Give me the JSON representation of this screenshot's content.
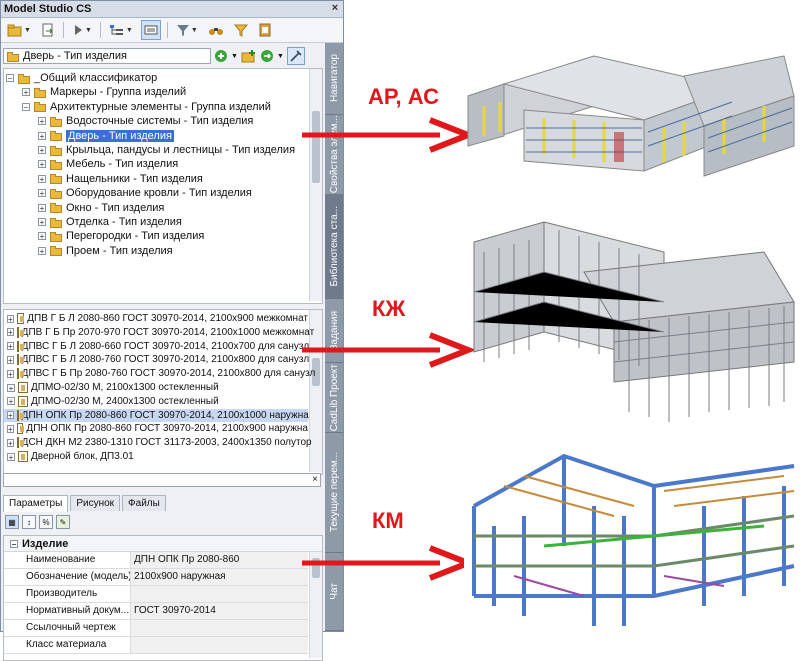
{
  "window": {
    "title": "Model Studio CS",
    "close_glyph": "×"
  },
  "path": {
    "value": "Дверь - Тип изделия"
  },
  "side_tabs": [
    "Навигатор",
    "Свойства элем...",
    "Библиотека ста...",
    "Задания",
    "CadLib Проект",
    "Текущие перем...",
    "Чат"
  ],
  "tree": {
    "items": [
      {
        "label": "_Общий классификатор",
        "level": 1,
        "pm": "−"
      },
      {
        "label": "Маркеры - Группа изделий",
        "level": 2,
        "pm": "+"
      },
      {
        "label": "Архитектурные элементы - Группа изделий",
        "level": 2,
        "pm": "−"
      },
      {
        "label": "Водосточные системы - Тип изделия",
        "level": 3,
        "pm": "+"
      },
      {
        "label": "Дверь - Тип изделия",
        "level": 3,
        "pm": "+",
        "selected": true
      },
      {
        "label": "Крыльца, пандусы и лестницы - Тип изделия",
        "level": 3,
        "pm": "+"
      },
      {
        "label": "Мебель - Тип изделия",
        "level": 3,
        "pm": "+"
      },
      {
        "label": "Нащельники - Тип изделия",
        "level": 3,
        "pm": "+"
      },
      {
        "label": "Оборудование кровли - Тип изделия",
        "level": 3,
        "pm": "+"
      },
      {
        "label": "Окно - Тип изделия",
        "level": 3,
        "pm": "+"
      },
      {
        "label": "Отделка - Тип изделия",
        "level": 3,
        "pm": "+"
      },
      {
        "label": "Перегородки - Тип изделия",
        "level": 3,
        "pm": "+"
      },
      {
        "label": "Проем - Тип изделия",
        "level": 3,
        "pm": "+"
      }
    ]
  },
  "list": {
    "items": [
      {
        "label": "ДПВ Г Б Л 2080-860  ГОСТ 30970-2014, 2100х900 межкомнат"
      },
      {
        "label": "ДПВ Г Б Пр 2070-970  ГОСТ 30970-2014, 2100х1000 межкомнат"
      },
      {
        "label": "ДПВС Г Б Л 2080-660  ГОСТ 30970-2014, 2100х700 для санузл"
      },
      {
        "label": "ДПВС Г Б Л 2080-760  ГОСТ 30970-2014, 2100х800 для санузл"
      },
      {
        "label": "ДПВС Г Б Пр 2080-760  ГОСТ 30970-2014, 2100х800 для санузл"
      },
      {
        "label": "ДПМО-02/30 М, 2100х1300 остекленный"
      },
      {
        "label": "ДПМО-02/30 М, 2400х1300 остекленный"
      },
      {
        "label": "ДПН ОПК Пр 2080-860  ГОСТ 30970-2014, 2100х1000 наружна",
        "selected": true
      },
      {
        "label": "ДПН ОПК Пр 2080-860  ГОСТ 30970-2014, 2100х900 наружна"
      },
      {
        "label": "ДСН ДКН М2 2380-1310 ГОСТ 31173-2003, 2400х1350 полутор"
      },
      {
        "label": "Дверной блок, ДП3.01"
      }
    ]
  },
  "filter": {
    "value": "",
    "clear_glyph": "×"
  },
  "tabs": [
    "Параметры",
    "Рисунок",
    "Файлы"
  ],
  "props": {
    "group": "Изделие",
    "rows": [
      {
        "name": "Наименование",
        "value": "ДПН ОПК Пр 2080-860"
      },
      {
        "name": "Обозначение (модель)",
        "value": "2100х900 наружная"
      },
      {
        "name": "Производитель",
        "value": ""
      },
      {
        "name": "Нормативный докум...",
        "value": "ГОСТ 30970-2014"
      },
      {
        "name": "Ссылочный чертеж",
        "value": ""
      },
      {
        "name": "Класс материала",
        "value": ""
      }
    ]
  },
  "callouts": [
    {
      "label": "АР, АС",
      "color": "#e0181b"
    },
    {
      "label": "КЖ",
      "color": "#e0181b"
    },
    {
      "label": "КМ",
      "color": "#e0181b"
    }
  ],
  "icons": [
    "folder-icon",
    "play-icon",
    "list-view-icon",
    "filter-icon",
    "binoculars-icon",
    "add-icon",
    "pin-icon",
    "sort-icon",
    "document-icon"
  ]
}
